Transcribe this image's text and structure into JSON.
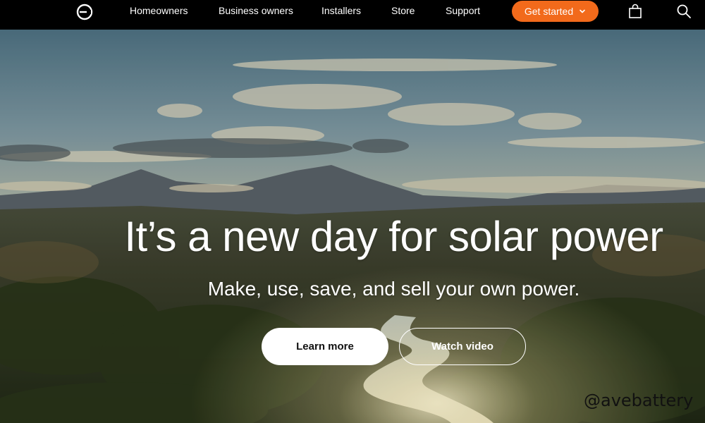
{
  "nav": {
    "logo_icon": "enphase-logo-icon",
    "links": [
      "Homeowners",
      "Business owners",
      "Installers",
      "Store",
      "Support"
    ],
    "cta_label": "Get started",
    "cta_color": "#f26a1b",
    "cart_icon": "shopping-bag-icon",
    "search_icon": "search-icon"
  },
  "hero": {
    "headline": "It’s a new day for solar power",
    "subhead": "Make, use, save, and sell your own power.",
    "primary_button": "Learn more",
    "secondary_button": "Watch video"
  },
  "watermark": "@avebattery"
}
